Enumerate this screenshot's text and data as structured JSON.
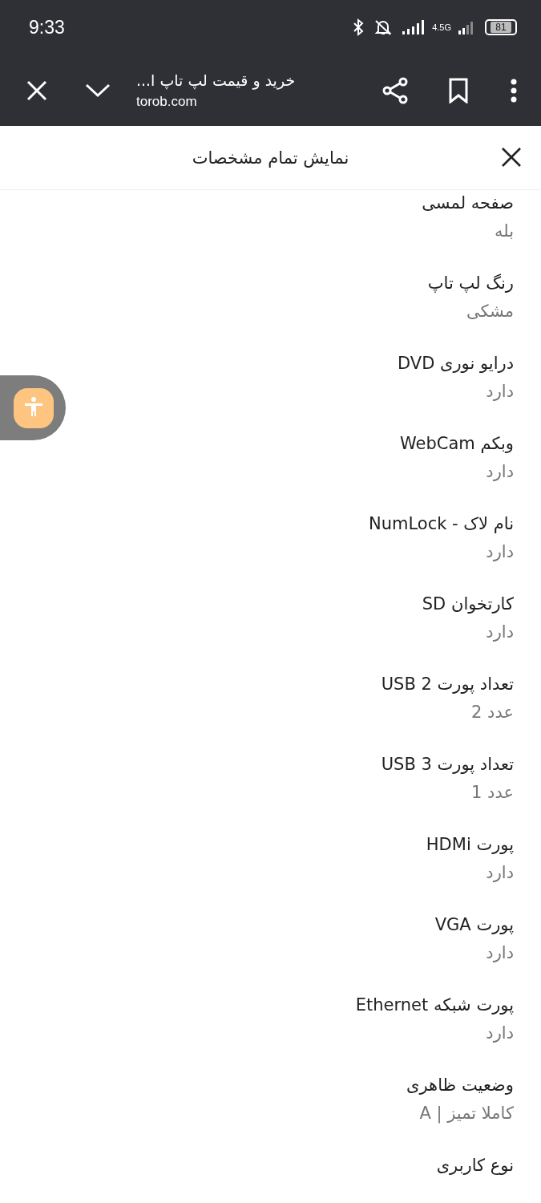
{
  "status_bar": {
    "time": "9:33",
    "network": "4.5G",
    "battery": "81"
  },
  "browser_bar": {
    "title": "خرید و قیمت لپ تاپ ا...",
    "url": "torob.com"
  },
  "sheet": {
    "title": "نمایش تمام مشخصات"
  },
  "specs": [
    {
      "label": "صفحه لمسی",
      "value": "بله"
    },
    {
      "label": "رنگ لپ تاپ",
      "value": "مشکی"
    },
    {
      "label": "درایو نوری DVD",
      "value": "دارد"
    },
    {
      "label": "وبکم WebCam",
      "value": "دارد"
    },
    {
      "label": "نام لاک - NumLock",
      "value": "دارد"
    },
    {
      "label": "کارتخوان SD",
      "value": "دارد"
    },
    {
      "label": "تعداد پورت USB 2",
      "value": "عدد 2"
    },
    {
      "label": "تعداد پورت USB 3",
      "value": "عدد 1"
    },
    {
      "label": "پورت HDMi",
      "value": "دارد"
    },
    {
      "label": "پورت VGA",
      "value": "دارد"
    },
    {
      "label": "پورت شبکه Ethernet",
      "value": "دارد"
    },
    {
      "label": "وضعیت ظاهری",
      "value": "کاملا تمیز | A"
    },
    {
      "label": "نوع کاربری"
    }
  ]
}
